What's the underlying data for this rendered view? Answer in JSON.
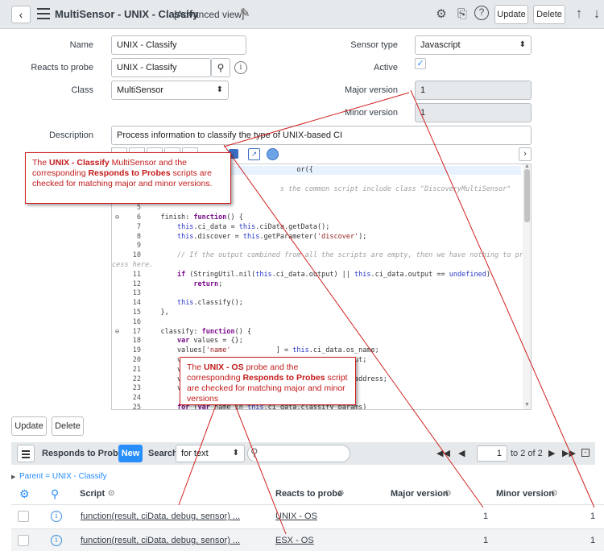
{
  "header": {
    "title": "MultiSensor - UNIX - Classify",
    "subtitle": "[Advanced view]",
    "update_label": "Update",
    "delete_label": "Delete"
  },
  "form": {
    "name_label": "Name",
    "name_value": "UNIX - Classify",
    "reacts_label": "Reacts to probe",
    "reacts_value": "UNIX - Classify",
    "class_label": "Class",
    "class_value": "MultiSensor",
    "sensor_type_label": "Sensor type",
    "sensor_type_value": "Javascript",
    "active_label": "Active",
    "active_checked": true,
    "major_label": "Major version",
    "major_value": "1",
    "minor_label": "Minor version",
    "minor_value": "1",
    "description_label": "Description",
    "description_value": "Process information to classify the type of UNIX-based CI"
  },
  "editor": {
    "lines": [
      {
        "n": "",
        "fold": "",
        "segs": [
          [
            "",
            "                                     or({"
          ]
        ]
      },
      {
        "n": "",
        "fold": "",
        "segs": [
          [
            "",
            ""
          ]
        ]
      },
      {
        "n": "",
        "fold": "",
        "segs": [
          [
            "cm",
            "                                 s the common script include class \"DiscoveryMultiSensor\""
          ]
        ]
      },
      {
        "n": "",
        "fold": "",
        "segs": [
          [
            "",
            ""
          ]
        ]
      },
      {
        "n": "5",
        "fold": "",
        "segs": [
          [
            "",
            ""
          ]
        ]
      },
      {
        "n": "6",
        "fold": "⊖",
        "segs": [
          [
            "",
            "    finish: "
          ],
          [
            "kw",
            "function"
          ],
          [
            "",
            "() {"
          ]
        ]
      },
      {
        "n": "7",
        "fold": "",
        "segs": [
          [
            "",
            "        "
          ],
          [
            "th",
            "this"
          ],
          [
            "",
            ".ci_data = "
          ],
          [
            "th",
            "this"
          ],
          [
            "",
            ".ciData.getData();"
          ]
        ]
      },
      {
        "n": "8",
        "fold": "",
        "segs": [
          [
            "",
            "        "
          ],
          [
            "th",
            "this"
          ],
          [
            "",
            ".discover = "
          ],
          [
            "th",
            "this"
          ],
          [
            "",
            ".getParameter("
          ],
          [
            "str",
            "'discover'"
          ],
          [
            "",
            ");"
          ]
        ]
      },
      {
        "n": "9",
        "fold": "",
        "segs": [
          [
            "",
            ""
          ]
        ]
      },
      {
        "n": "10",
        "fold": "",
        "segs": [
          [
            "cm",
            "        // If the output combined from all the scripts are empty, then we have nothing to pro"
          ]
        ]
      },
      {
        "n": "",
        "fold": "",
        "segs": [
          [
            "cm",
            "cess here."
          ]
        ],
        "wrap": true
      },
      {
        "n": "11",
        "fold": "",
        "segs": [
          [
            "",
            "        "
          ],
          [
            "kw",
            "if"
          ],
          [
            "",
            " (StringUtil.nil("
          ],
          [
            "th",
            "this"
          ],
          [
            "",
            ".ci_data.output) || "
          ],
          [
            "th",
            "this"
          ],
          [
            "",
            ".ci_data.output == "
          ],
          [
            "th",
            "undefined"
          ],
          [
            "",
            ")"
          ]
        ]
      },
      {
        "n": "12",
        "fold": "",
        "segs": [
          [
            "",
            "            "
          ],
          [
            "kw",
            "return"
          ],
          [
            "",
            ";"
          ]
        ]
      },
      {
        "n": "13",
        "fold": "",
        "segs": [
          [
            "",
            ""
          ]
        ]
      },
      {
        "n": "14",
        "fold": "",
        "segs": [
          [
            "",
            "        "
          ],
          [
            "th",
            "this"
          ],
          [
            "",
            ".classify();"
          ]
        ]
      },
      {
        "n": "15",
        "fold": "",
        "segs": [
          [
            "",
            "    },"
          ]
        ]
      },
      {
        "n": "16",
        "fold": "",
        "segs": [
          [
            "",
            ""
          ]
        ]
      },
      {
        "n": "17",
        "fold": "⊖",
        "segs": [
          [
            "",
            "    classify: "
          ],
          [
            "kw",
            "function"
          ],
          [
            "",
            "() {"
          ]
        ]
      },
      {
        "n": "18",
        "fold": "",
        "segs": [
          [
            "",
            "        "
          ],
          [
            "kw",
            "var"
          ],
          [
            "",
            " values = {};"
          ]
        ]
      },
      {
        "n": "19",
        "fold": "",
        "segs": [
          [
            "",
            "        values["
          ],
          [
            "str",
            "'name'"
          ],
          [
            "",
            "           ] = "
          ],
          [
            "th",
            "this"
          ],
          [
            "",
            ".ci_data.os_name;"
          ]
        ]
      },
      {
        "n": "20",
        "fold": "",
        "segs": [
          [
            "",
            "        v                                          ut;"
          ]
        ]
      },
      {
        "n": "21",
        "fold": "",
        "segs": [
          [
            "",
            "        v"
          ]
        ]
      },
      {
        "n": "22",
        "fold": "",
        "segs": [
          [
            "",
            "        v                                          address;"
          ]
        ]
      },
      {
        "n": "23",
        "fold": "",
        "segs": [
          [
            "",
            "        v"
          ]
        ]
      },
      {
        "n": "24",
        "fold": "",
        "segs": [
          [
            "",
            ""
          ]
        ]
      },
      {
        "n": "25",
        "fold": "",
        "segs": [
          [
            "",
            "        "
          ],
          [
            "kw",
            "for"
          ],
          [
            "",
            " ("
          ],
          [
            "kw",
            "var"
          ],
          [
            "",
            " name in "
          ],
          [
            "th",
            "this"
          ],
          [
            "",
            ".ci_data.classify_params)"
          ]
        ]
      }
    ]
  },
  "callout1": {
    "pre": "The ",
    "b1": "UNIX - Classify",
    "mid": " MultiSensor and the corresponding ",
    "b2": "Responds to Probes",
    "post": " scripts are checked for matching major and minor versions."
  },
  "callout2": {
    "pre": "The ",
    "b1": "UNIX - OS",
    "mid": " probe and the corresponding ",
    "b2": "Responds to Probes",
    "post": " script are checked for matching major and minor versions"
  },
  "bottom_actions": {
    "update_label": "Update",
    "delete_label": "Delete"
  },
  "related": {
    "title": "Responds to Probes",
    "new_label": "New",
    "search_label": "Search",
    "search_field": "for text",
    "page_value": "1",
    "page_of": "to 2 of 2",
    "breadcrumb": "Parent = UNIX - Classify",
    "columns": {
      "script": "Script",
      "reacts": "Reacts to probe",
      "major": "Major version",
      "minor": "Minor version"
    },
    "rows": [
      {
        "script": "function(result, ciData, debug, sensor) ...",
        "reacts": "UNIX - OS",
        "major": "1",
        "minor": "1"
      },
      {
        "script": "function(result, ciData, debug, sensor) ...",
        "reacts": "ESX - OS",
        "major": "1",
        "minor": "1"
      }
    ]
  },
  "colors": {
    "accent": "#278efc",
    "callout": "#d12020",
    "header_bg": "#e6e9eb"
  }
}
